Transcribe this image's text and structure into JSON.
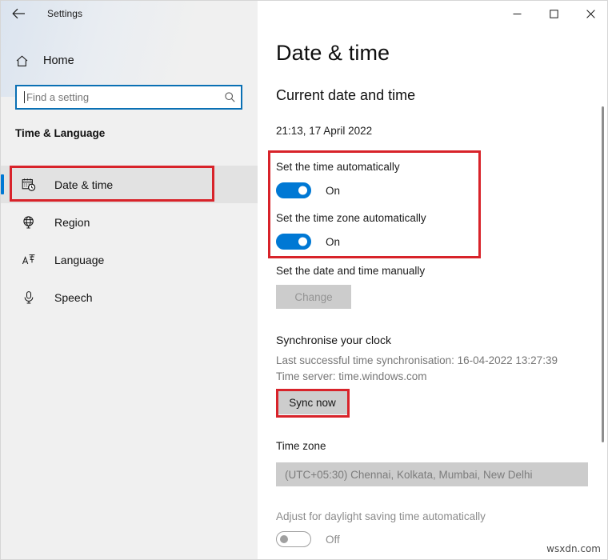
{
  "window": {
    "app_title": "Settings",
    "back_icon": "back-arrow-icon",
    "minimize_icon": "minimize-icon",
    "maximize_icon": "maximize-icon",
    "close_icon": "close-icon"
  },
  "sidebar": {
    "home_label": "Home",
    "home_icon": "home-icon",
    "search": {
      "placeholder": "Find a setting",
      "value": "",
      "icon": "search-icon"
    },
    "category_title": "Time & Language",
    "items": [
      {
        "label": "Date & time",
        "icon": "calendar-clock-icon",
        "selected": true
      },
      {
        "label": "Region",
        "icon": "globe-icon",
        "selected": false
      },
      {
        "label": "Language",
        "icon": "language-icon",
        "selected": false
      },
      {
        "label": "Speech",
        "icon": "microphone-icon",
        "selected": false
      }
    ]
  },
  "main": {
    "page_title": "Date & time",
    "current_section_heading": "Current date and time",
    "current_datetime": "21:13, 17 April 2022",
    "set_time_auto": {
      "label": "Set the time automatically",
      "state": "On",
      "enabled": true
    },
    "set_timezone_auto": {
      "label": "Set the time zone automatically",
      "state": "On",
      "enabled": true
    },
    "set_manually": {
      "label": "Set the date and time manually",
      "button_label": "Change",
      "disabled": true
    },
    "sync": {
      "heading": "Synchronise your clock",
      "last_sync": "Last successful time synchronisation: 16-04-2022 13:27:39",
      "time_server": "Time server: time.windows.com",
      "button_label": "Sync now"
    },
    "time_zone": {
      "heading": "Time zone",
      "selected": "(UTC+05:30) Chennai, Kolkata, Mumbai, New Delhi",
      "disabled": true
    },
    "daylight_saving": {
      "label": "Adjust for daylight saving time automatically",
      "state": "Off",
      "enabled": false
    }
  },
  "annotations": {
    "accent_color": "#0078d4",
    "highlight_color": "#d8232a",
    "highlights": [
      "sidebar-date-time-item",
      "auto-time-toggles-group",
      "sync-now-button"
    ]
  },
  "watermark": "wsxdn.com"
}
